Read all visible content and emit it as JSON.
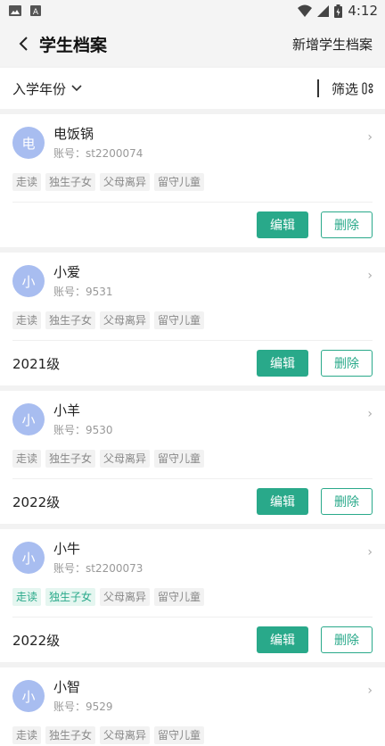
{
  "statusbar": {
    "time": "4:12"
  },
  "header": {
    "title": "学生档案",
    "add_label": "新增学生档案"
  },
  "filter": {
    "year_label": "入学年份",
    "filter_label": "筛选"
  },
  "actions": {
    "edit": "编辑",
    "delete": "删除"
  },
  "students": [
    {
      "avatar": "电",
      "name": "电饭锅",
      "account": "账号：st2200074",
      "tags": [
        {
          "label": "走读",
          "active": false
        },
        {
          "label": "独生子女",
          "active": false
        },
        {
          "label": "父母离异",
          "active": false
        },
        {
          "label": "留守儿童",
          "active": false
        }
      ],
      "grade": ""
    },
    {
      "avatar": "小",
      "name": "小爱",
      "account": "账号：9531",
      "tags": [
        {
          "label": "走读",
          "active": false
        },
        {
          "label": "独生子女",
          "active": false
        },
        {
          "label": "父母离异",
          "active": false
        },
        {
          "label": "留守儿童",
          "active": false
        }
      ],
      "grade": "2021级"
    },
    {
      "avatar": "小",
      "name": "小羊",
      "account": "账号：9530",
      "tags": [
        {
          "label": "走读",
          "active": false
        },
        {
          "label": "独生子女",
          "active": false
        },
        {
          "label": "父母离异",
          "active": false
        },
        {
          "label": "留守儿童",
          "active": false
        }
      ],
      "grade": "2022级"
    },
    {
      "avatar": "小",
      "name": "小牛",
      "account": "账号：st2200073",
      "tags": [
        {
          "label": "走读",
          "active": true
        },
        {
          "label": "独生子女",
          "active": true
        },
        {
          "label": "父母离异",
          "active": false
        },
        {
          "label": "留守儿童",
          "active": false
        }
      ],
      "grade": "2022级"
    },
    {
      "avatar": "小",
      "name": "小智",
      "account": "账号：9529",
      "tags": [
        {
          "label": "走读",
          "active": false
        },
        {
          "label": "独生子女",
          "active": false
        },
        {
          "label": "父母离异",
          "active": false
        },
        {
          "label": "留守儿童",
          "active": false
        }
      ],
      "grade": ""
    }
  ],
  "colors": {
    "accent": "#29a98a",
    "avatar_bg": "#a8bdf0"
  }
}
